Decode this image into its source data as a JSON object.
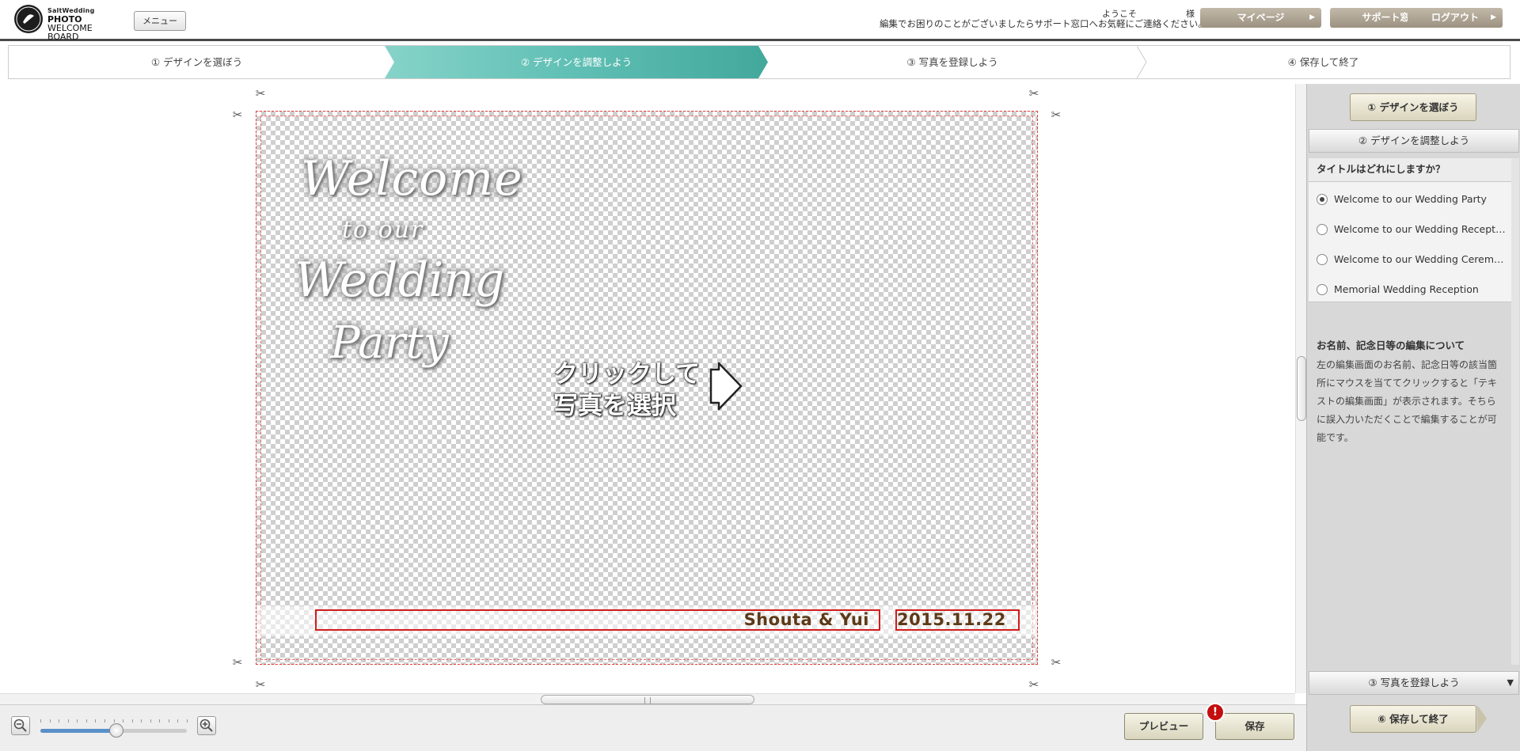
{
  "header": {
    "logo_small": "SaltWedding",
    "logo_line1": "PHOTO",
    "logo_line2": "WELCOME BOARD",
    "menu_label": "メニュー",
    "welcome_text": "ようこそ",
    "honorific": "様",
    "contact_text": "編集でお困りのことがございましたらサポート窓口へお気軽にご連絡ください。",
    "buttons": [
      {
        "label": "マイページ"
      },
      {
        "label": "サポート窓口"
      },
      {
        "label": "ログアウト"
      }
    ]
  },
  "steps": [
    {
      "label": "① デザインを選ぼう",
      "active": false
    },
    {
      "label": "② デザインを調整しよう",
      "active": true
    },
    {
      "label": "③ 写真を登録しよう",
      "active": false
    },
    {
      "label": "④ 保存して終了",
      "active": false
    }
  ],
  "colors": {
    "active_step": "#5fbfb4",
    "name_text": "#5e3a17",
    "box_border": "#d21c1c",
    "alert": "#c40e0e"
  },
  "board": {
    "title_lines": [
      "Welcome",
      "to our",
      "Wedding",
      "Party"
    ],
    "click_hint_line1": "クリックして",
    "click_hint_line2": "写真を選択",
    "names": "Shouta & Yui",
    "date": "2015.11.22"
  },
  "toolbar": {
    "zoom_out_icon": "zoom-out-icon",
    "zoom_in_icon": "zoom-in-icon",
    "zoom_level": 0.52,
    "preview_label": "プレビュー",
    "save_label": "保存",
    "alert_mark": "!"
  },
  "panel": {
    "back_button_label": "① デザインを選ぼう",
    "section_adjust": "② デザインを調整しよう",
    "question": "タイトルはどれにしますか？",
    "options": [
      {
        "label": "Welcome to our Wedding Party",
        "selected": true
      },
      {
        "label": "Welcome to our Wedding Reception",
        "selected": false
      },
      {
        "label": "Welcome to our Wedding Ceremony",
        "selected": false
      },
      {
        "label": "Memorial Wedding Reception",
        "selected": false
      }
    ],
    "info_title": "お名前、記念日等の編集について",
    "info_body": "左の編集画面のお名前、記念日等の該当箇所にマウスを当ててクリックすると「テキストの編集画面」が表示されます。そちらに誤入力いただくことで編集することが可能です。",
    "section_photo": "③ 写真を登録しよう",
    "finish_button_label": "⑥ 保存して終了"
  }
}
